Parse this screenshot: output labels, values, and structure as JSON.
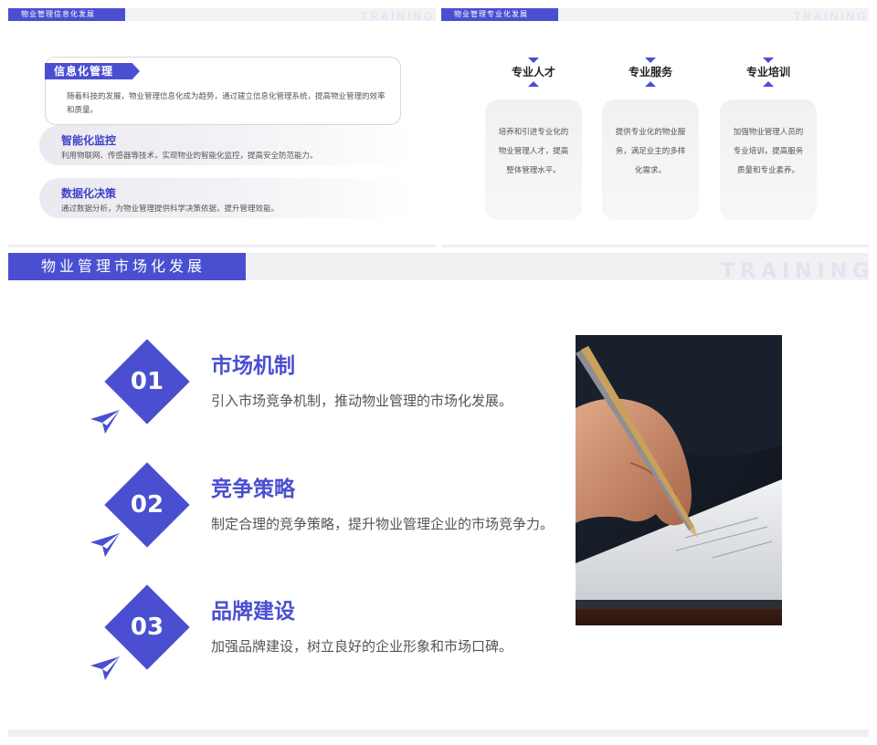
{
  "panel_a": {
    "header": "物业管理信息化发展",
    "watermark": "TRAINING",
    "item_main": {
      "title": "信息化管理",
      "desc": "随着科技的发展，物业管理信息化成为趋势，通过建立信息化管理系统，提高物业管理的效率和质量。"
    },
    "item_2": {
      "title": "智能化监控",
      "desc": "利用物联网、传感器等技术，实现物业的智能化监控，提高安全防范能力。"
    },
    "item_3": {
      "title": "数据化决策",
      "desc": "通过数据分析，为物业管理提供科学决策依据，提升管理效能。"
    }
  },
  "panel_b": {
    "header": "物业管理专业化发展",
    "watermark": "TRAINING",
    "cards": [
      {
        "title": "专业人才",
        "desc": "培养和引进专业化的物业管理人才，提高整体管理水平。"
      },
      {
        "title": "专业服务",
        "desc": "提供专业化的物业服务，满足业主的多样化需求。"
      },
      {
        "title": "专业培训",
        "desc": "加强物业管理人员的专业培训，提高服务质量和专业素养。"
      }
    ]
  },
  "panel_c": {
    "header": "物业管理市场化发展",
    "watermark": "TRAINING",
    "steps": [
      {
        "num": "01",
        "title": "市场机制",
        "desc": "引入市场竞争机制，推动物业管理的市场化发展。"
      },
      {
        "num": "02",
        "title": "竞争策略",
        "desc": "制定合理的竞争策略，提升物业管理企业的市场竞争力。"
      },
      {
        "num": "03",
        "title": "品牌建设",
        "desc": "加强品牌建设，树立良好的企业形象和市场口碑。"
      }
    ]
  },
  "colors": {
    "accent": "#4a4fd1",
    "band": "#f1f1f4"
  }
}
